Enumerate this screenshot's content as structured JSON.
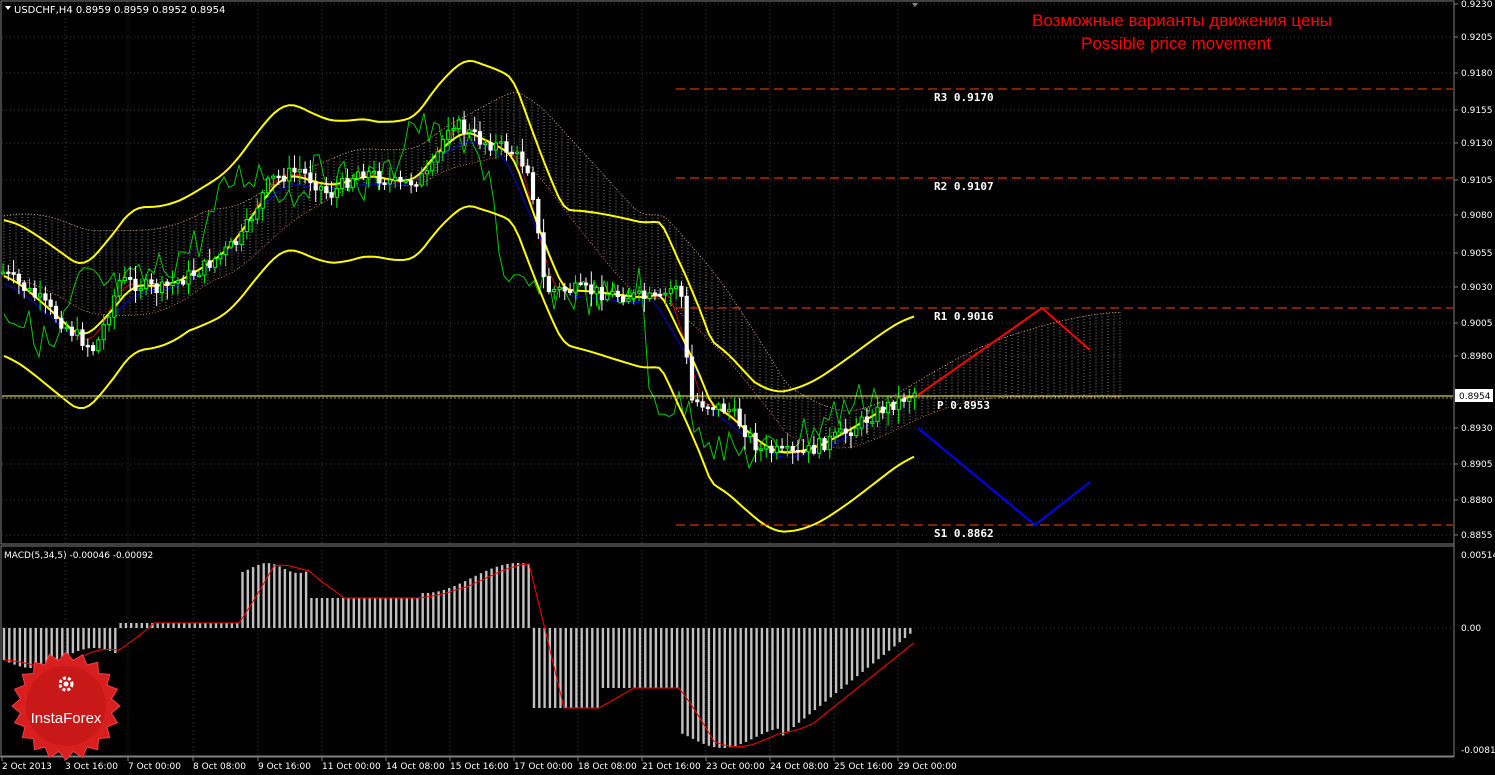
{
  "header": {
    "symbol_info": "USDCHF,H4  0.8959 0.8959 0.8952 0.8954",
    "title_ru": "Возможные варианты движения цены",
    "title_en": "Possible price movement"
  },
  "price_axis": {
    "ticks": [
      "0.9230",
      "0.9205",
      "0.9180",
      "0.9155",
      "0.9130",
      "0.9105",
      "0.9080",
      "0.9055",
      "0.9030",
      "0.9005",
      "0.8980",
      "0.8930",
      "0.8905",
      "0.8880",
      "0.8855"
    ],
    "current_price": "0.8954"
  },
  "levels": {
    "r3": "R3  0.9170",
    "r2": "R2  0.9107",
    "r1": "R1  0.9016",
    "p": "P  0.8953",
    "s1": "S1  0.8862"
  },
  "macd": {
    "label": "MACD(5,34,5) -0.00046 -0.00092",
    "axis_ticks": [
      "0.00514",
      "0.00",
      "-0.0081"
    ]
  },
  "time_axis": {
    "labels": [
      "2 Oct 2013",
      "3 Oct 16:00",
      "7 Oct 00:00",
      "8 Oct 08:00",
      "9 Oct 16:00",
      "11 Oct 00:00",
      "14 Oct 08:00",
      "15 Oct 16:00",
      "17 Oct 00:00",
      "18 Oct 08:00",
      "21 Oct 16:00",
      "23 Oct 00:00",
      "24 Oct 08:00",
      "25 Oct 16:00",
      "29 Oct 00:00"
    ]
  },
  "logo": {
    "text": "InstaForex"
  },
  "colors": {
    "bull": "#00ff00",
    "bear": "#ffffff",
    "bollinger": "#ffff00",
    "levels": "#ff4400",
    "scenario_up": "#ff0000",
    "scenario_down": "#0000ff",
    "macd_signal": "#ff0000",
    "macd_hist": "#c0c0c0",
    "grid": "#3a3a3a"
  }
}
